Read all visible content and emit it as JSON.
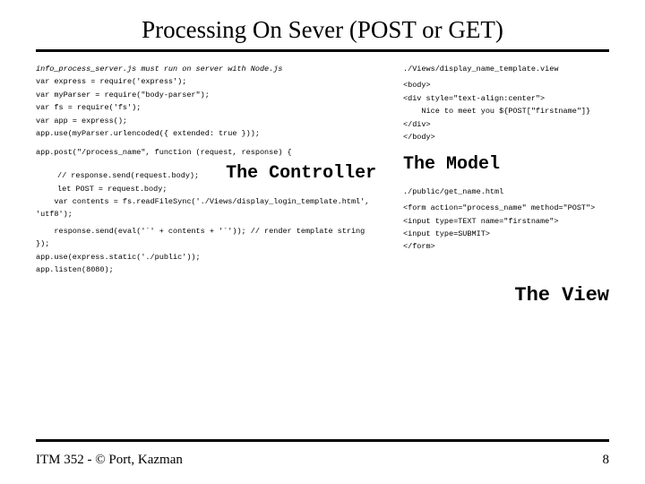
{
  "title": "Processing On Sever (POST or GET)",
  "left": {
    "header_italic": "info_process_server.js must run on server with Node.js",
    "l1": "var express = require('express');",
    "l2": "var myParser = require(\"body-parser\");",
    "l3": "var fs = require('fs');",
    "l4": "var app = express();",
    "l5": "app.use(myParser.urlencoded({ extended: true }));",
    "l6": "app.post(\"/process_name\", function (request, response) {",
    "l7a": "// response.send(request.body);",
    "l7b": "let POST = request.body;",
    "l8": "    var contents = fs.readFileSync('./Views/display_login_template.html', 'utf8');",
    "l9": "    response.send(eval('`' + contents + '`')); // render template string",
    "l10": "});",
    "l11": "app.use(express.static('./public'));",
    "l12": "app.listen(8080);"
  },
  "labels": {
    "controller": "The Controller",
    "model": "The Model",
    "view": "The View"
  },
  "right": {
    "path1": "./Views/display_name_template.view",
    "b1": "<body>",
    "b2": "<div style=\"text-align:center\">",
    "b3": "    Nice to meet you ${POST[\"firstname\"]}",
    "b4": "</div>",
    "b5": "</body>",
    "path2": "./public/get_name.html",
    "f1": "<form action=\"process_name\" method=\"POST\">",
    "f2": "<input type=TEXT name=\"firstname\">",
    "f3": "<input type=SUBMIT>",
    "f4": "</form>"
  },
  "footer": {
    "left": "ITM 352 - © Port, Kazman",
    "right": "8"
  }
}
